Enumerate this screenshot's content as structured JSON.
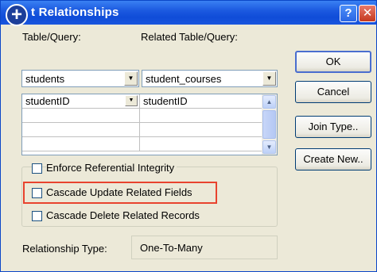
{
  "window": {
    "title": "t Relationships",
    "help_glyph": "?",
    "close_glyph": "✕",
    "app_icon": "plus-icon"
  },
  "table_query": {
    "label": "Table/Query:",
    "value": "students"
  },
  "related_table_query": {
    "label": "Related Table/Query:",
    "value": "student_courses"
  },
  "fields_grid": {
    "rows": [
      {
        "left": "studentID",
        "right": "studentID"
      },
      {
        "left": "",
        "right": ""
      },
      {
        "left": "",
        "right": ""
      },
      {
        "left": "",
        "right": ""
      }
    ]
  },
  "options": {
    "enforce_integrity": {
      "label": "Enforce Referential Integrity",
      "checked": false
    },
    "cascade_update": {
      "label": "Cascade Update Related Fields",
      "checked": false
    },
    "cascade_delete": {
      "label": "Cascade Delete Related Records",
      "checked": false
    }
  },
  "relationship_type": {
    "label": "Relationship Type:",
    "value": "One-To-Many"
  },
  "buttons": {
    "ok": "OK",
    "cancel": "Cancel",
    "join_type": "Join Type..",
    "create_new": "Create New.."
  },
  "colors": {
    "titlebar": "#0f4cd8",
    "highlight_border": "#e8432e",
    "dialog_bg": "#ece9d8"
  }
}
